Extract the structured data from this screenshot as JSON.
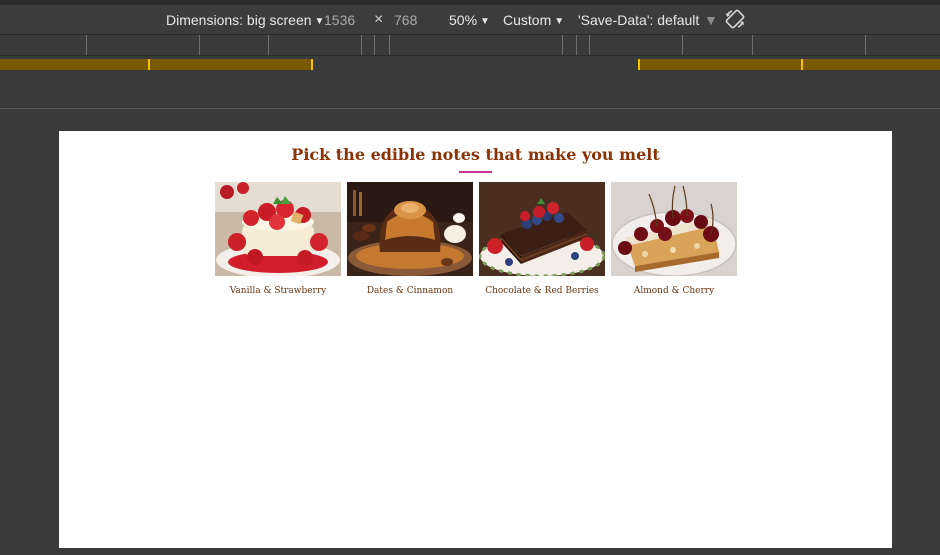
{
  "devtools": {
    "dimensions_label": "Dimensions: big screen",
    "width": "1536",
    "times": "×",
    "height": "768",
    "zoom": "50%",
    "throttle": "Custom",
    "save_data": "'Save-Data': default",
    "caret": "▼",
    "rotate_icon": "rotate-icon"
  },
  "page": {
    "title": "Pick the edible notes that make you melt",
    "title_color": "#8b3306",
    "accent_color": "#c8348f"
  },
  "desserts": [
    {
      "caption": "Vanilla & Strawberry",
      "image": "strawberry-panna-cotta"
    },
    {
      "caption": "Dates & Cinnamon",
      "image": "caramel-lava-cake"
    },
    {
      "caption": "Chocolate & Red Berries",
      "image": "chocolate-berry-cake"
    },
    {
      "caption": "Almond & Cherry",
      "image": "cherry-almond-tart"
    }
  ]
}
